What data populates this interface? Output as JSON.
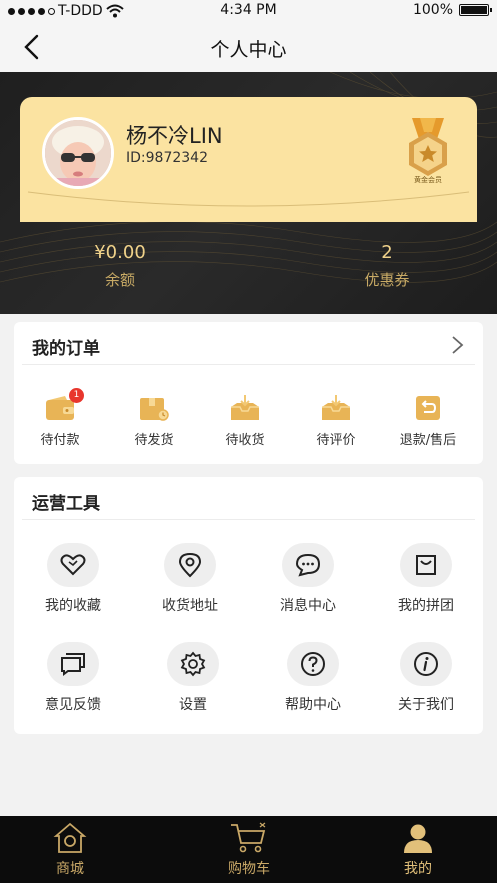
{
  "status_bar": {
    "carrier": "T-DDD",
    "time": "4:34 PM",
    "battery": "100%"
  },
  "nav": {
    "title": "个人中心",
    "back_icon": "chevron-left-icon"
  },
  "profile": {
    "name": "杨不冷LIN",
    "id": "ID:9872342",
    "medal_label": "黄金会员"
  },
  "stats": [
    {
      "value": "¥0.00",
      "label": "余额"
    },
    {
      "value": "2",
      "label": "优惠券"
    }
  ],
  "orders": {
    "title": "我的订单",
    "items": [
      {
        "label": "待付款",
        "icon": "wallet-icon",
        "badge": "1"
      },
      {
        "label": "待发货",
        "icon": "package-icon"
      },
      {
        "label": "待收货",
        "icon": "inbox-download-icon"
      },
      {
        "label": "待评价",
        "icon": "inbox-review-icon"
      },
      {
        "label": "退款/售后",
        "icon": "return-icon"
      }
    ]
  },
  "tools": {
    "title": "运营工具",
    "items": [
      {
        "label": "我的收藏",
        "icon": "heart-icon"
      },
      {
        "label": "收货地址",
        "icon": "location-pin-icon"
      },
      {
        "label": "消息中心",
        "icon": "chat-bubble-icon"
      },
      {
        "label": "我的拼团",
        "icon": "shopping-bag-icon"
      },
      {
        "label": "意见反馈",
        "icon": "feedback-icon"
      },
      {
        "label": "设置",
        "icon": "gear-icon"
      },
      {
        "label": "帮助中心",
        "icon": "question-icon"
      },
      {
        "label": "关于我们",
        "icon": "info-icon"
      }
    ]
  },
  "tabs": [
    {
      "label": "商城",
      "icon": "home-icon"
    },
    {
      "label": "购物车",
      "icon": "cart-icon"
    },
    {
      "label": "我的",
      "icon": "user-icon",
      "active": true
    }
  ],
  "colors": {
    "gold": "#c9a867",
    "card_gold": "#fbe3a1",
    "dark": "#1f1f1f",
    "badge": "#e8362d"
  }
}
